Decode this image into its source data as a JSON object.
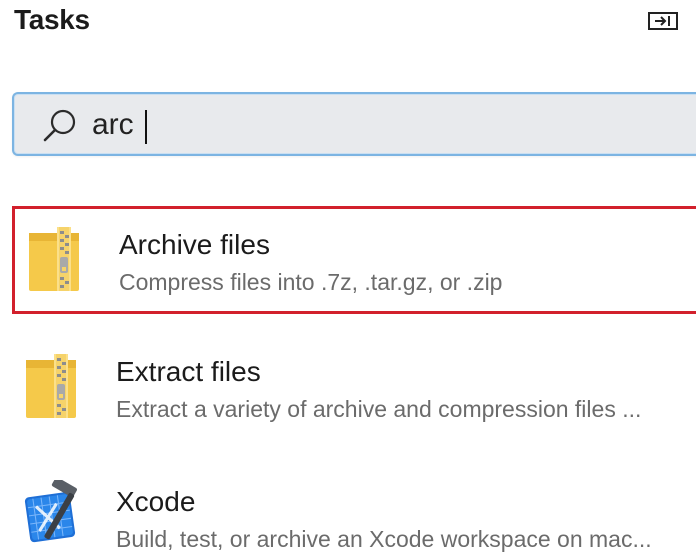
{
  "header": {
    "title": "Tasks",
    "collapse_icon": "collapse-panel-icon"
  },
  "search": {
    "icon": "search-icon",
    "value": "arc"
  },
  "results": [
    {
      "icon": "zip-folder-icon",
      "title": "Archive files",
      "description": "Compress files into .7z, .tar.gz, or .zip",
      "selected": true
    },
    {
      "icon": "zip-folder-icon",
      "title": "Extract files",
      "description": "Extract a variety of archive and compression files ..."
    },
    {
      "icon": "xcode-icon",
      "title": "Xcode",
      "description": "Build, test, or archive an Xcode workspace on mac..."
    }
  ],
  "colors": {
    "selection_border": "#d2202c",
    "search_border": "#7cb4e2",
    "folder_yellow": "#f5c94a"
  }
}
